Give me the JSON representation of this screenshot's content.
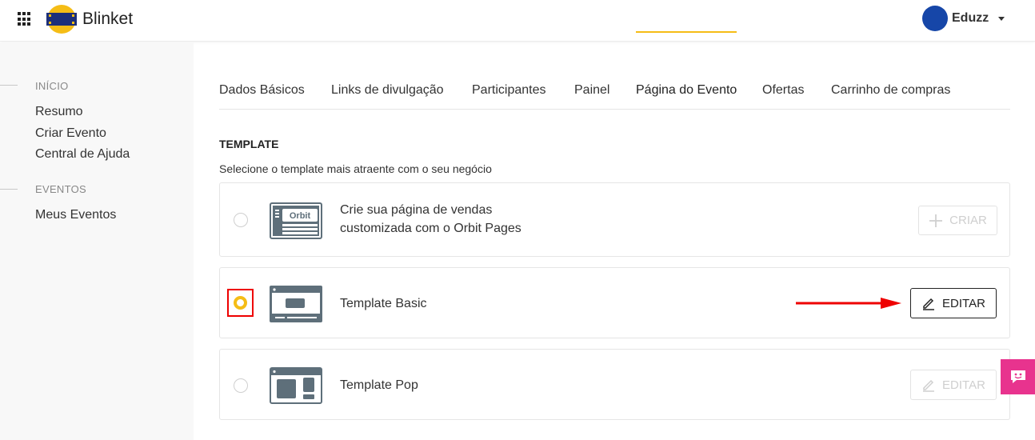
{
  "header": {
    "brand": "Blinket",
    "user_name": "Eduzz",
    "colors": {
      "avatar": "#1646a8",
      "logo_yellow": "#f5bd16",
      "logo_navy": "#1c2f7a"
    }
  },
  "sidebar": {
    "sections": [
      {
        "heading": "INÍCIO",
        "items": [
          "Resumo",
          "Criar Evento",
          "Central de Ajuda"
        ]
      },
      {
        "heading": "EVENTOS",
        "items": [
          "Meus Eventos"
        ]
      }
    ]
  },
  "tabs": {
    "items": [
      "Dados Básicos",
      "Links de divulgação",
      "Participantes",
      "Painel",
      "Página do Evento",
      "Ofertas",
      "Carrinho de compras"
    ],
    "active": "Página do Evento",
    "accent": "#f5bd16"
  },
  "template_section": {
    "title": "TEMPLATE",
    "subtitle": "Selecione o template mais atraente com o seu negócio"
  },
  "cards": [
    {
      "thumb": "orbit-pages-icon",
      "thumb_text": "Orbit",
      "text_line1": "Crie sua página de vendas",
      "text_line2": "customizada com o Orbit Pages",
      "button": "CRIAR",
      "button_icon": "plus-icon",
      "selected": false,
      "button_enabled": false
    },
    {
      "thumb": "template-basic-icon",
      "text_line1": "Template Basic",
      "button": "EDITAR",
      "button_icon": "pencil-icon",
      "selected": true,
      "button_enabled": true
    },
    {
      "thumb": "template-pop-icon",
      "text_line1": "Template Pop",
      "button": "EDITAR",
      "button_icon": "pencil-icon",
      "selected": false,
      "button_enabled": false
    }
  ],
  "annotations": {
    "highlight_color": "#ee0000"
  },
  "chat_widget": {
    "icon": "chat-face-icon",
    "color": "#e8338e"
  }
}
